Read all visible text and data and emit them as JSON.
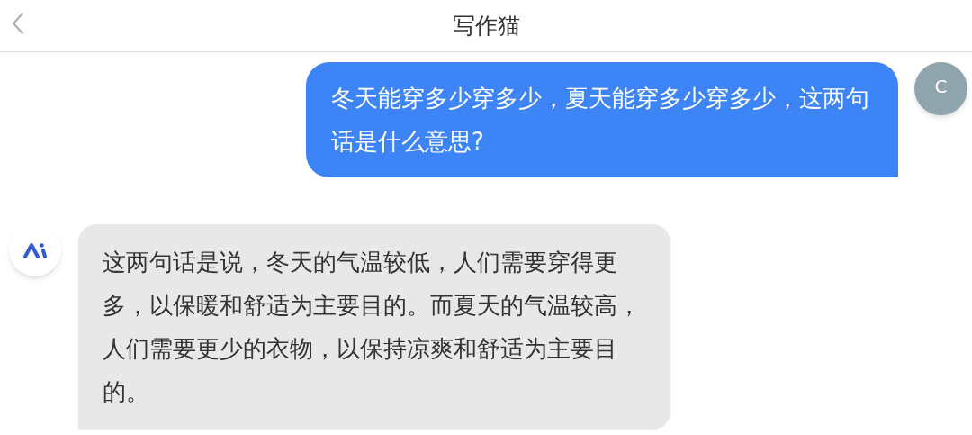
{
  "header": {
    "title": "写作猫"
  },
  "messages": [
    {
      "kind": "user",
      "avatar": "C",
      "text": "冬天能穿多少穿多少，夏天能穿多少穿多少，这两句话是什么意思?"
    },
    {
      "kind": "ai",
      "text": "这两句话是说，冬天的气温较低，人们需要穿得更多，以保暖和舒适为主要目的。而夏天的气温较高，人们需要更少的衣物，以保持凉爽和舒适为主要目的。"
    }
  ]
}
